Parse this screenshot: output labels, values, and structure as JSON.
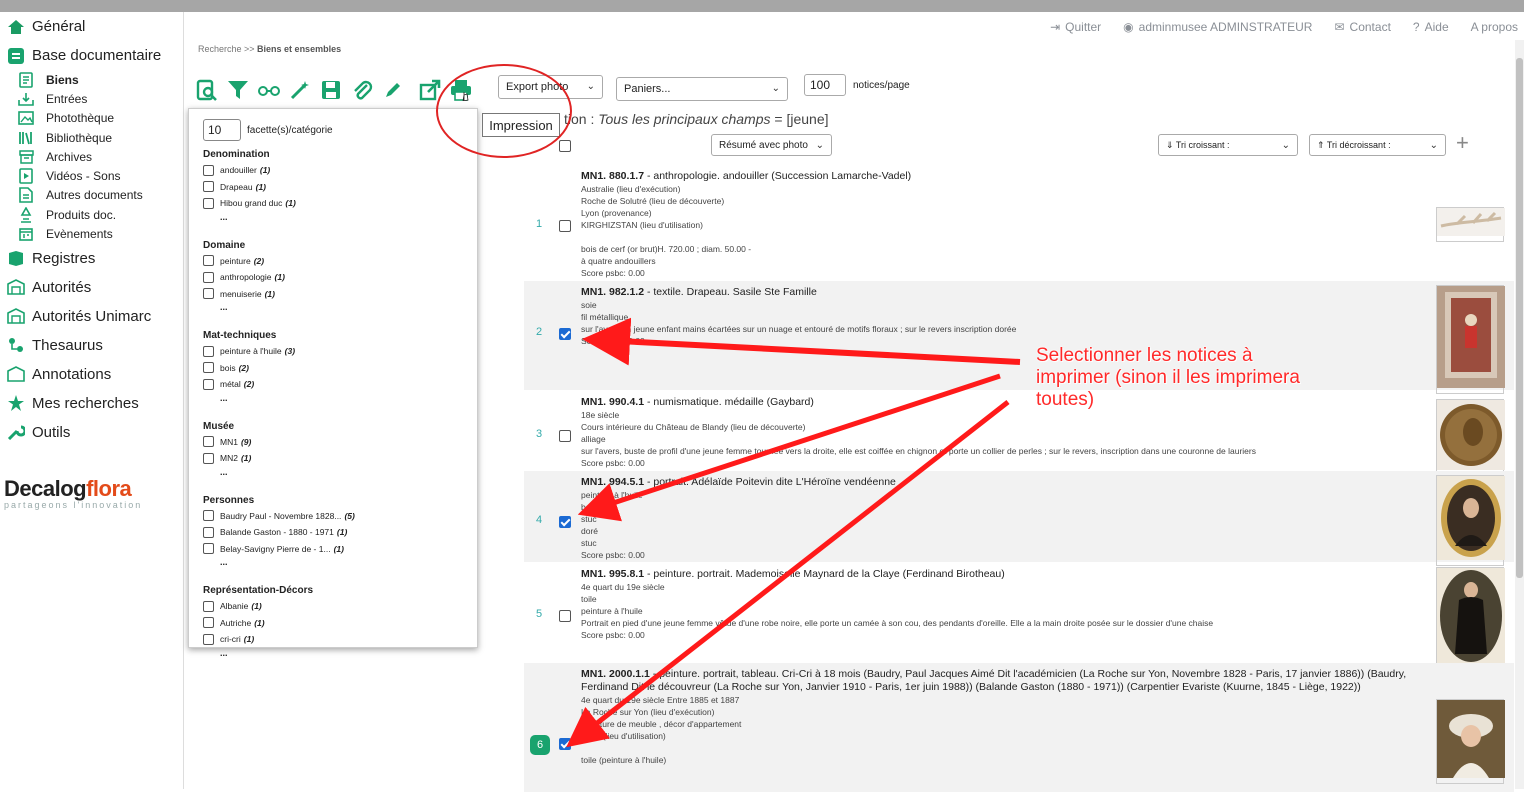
{
  "nav": {
    "items": [
      {
        "label": "Général",
        "icon": "home-icon",
        "color": "#1a9b63"
      },
      {
        "label": "Base documentaire",
        "icon": "database-icon",
        "color": "#19a36e"
      }
    ],
    "sub_items": [
      {
        "label": "Biens",
        "icon": "biens-icon",
        "active": true
      },
      {
        "label": "Entrées",
        "icon": "inbox-icon"
      },
      {
        "label": "Photothèque",
        "icon": "photo-icon"
      },
      {
        "label": "Bibliothèque",
        "icon": "library-icon"
      },
      {
        "label": "Archives",
        "icon": "archive-icon"
      },
      {
        "label": "Vidéos - Sons",
        "icon": "video-icon"
      },
      {
        "label": "Autres documents",
        "icon": "document-icon"
      },
      {
        "label": "Produits doc.",
        "icon": "product-icon"
      },
      {
        "label": "Evènements",
        "icon": "calendar-icon"
      }
    ],
    "items2": [
      {
        "label": "Registres",
        "icon": "register-icon"
      },
      {
        "label": "Autorités",
        "icon": "authority-icon"
      },
      {
        "label": "Autorités Unimarc",
        "icon": "authority-icon"
      },
      {
        "label": "Thesaurus",
        "icon": "thesaurus-icon"
      },
      {
        "label": "Annotations",
        "icon": "annotation-icon"
      },
      {
        "label": "Mes recherches",
        "icon": "star-icon"
      },
      {
        "label": "Outils",
        "icon": "wrench-icon"
      }
    ]
  },
  "logo": {
    "word1": "Decalog",
    "word2": "flora",
    "tagline": "partageons l'innovation"
  },
  "topbar": {
    "quit": "Quitter",
    "user": "adminmusee ADMINSTRATEUR",
    "contact": "Contact",
    "help": "Aide",
    "about": "A propos"
  },
  "breadcrumb": {
    "root": "Recherche >> ",
    "current": "Biens et ensembles"
  },
  "toolbar": {
    "export": "Export photo",
    "baskets": "Paniers...",
    "per_page": "100",
    "per_page_label": "notices/page",
    "tooltip": "Impression"
  },
  "query": {
    "prefix": "tion : ",
    "text": "Tous les principaux champs",
    "suffix": " = [jeune]"
  },
  "sort": {
    "display": "Résumé avec photo",
    "asc": "⇓ Tri croissant :",
    "desc": "⇑ Tri décroissant :",
    "add": "+"
  },
  "facet": {
    "count": "10",
    "count_label": "facette(s)/catégorie",
    "more": "...",
    "groups": [
      {
        "title": "Denomination",
        "items": [
          {
            "label": "andouiller",
            "n": "(1)"
          },
          {
            "label": "Drapeau",
            "n": "(1)"
          },
          {
            "label": "Hibou grand duc",
            "n": "(1)"
          }
        ]
      },
      {
        "title": "Domaine",
        "items": [
          {
            "label": "peinture",
            "n": "(2)"
          },
          {
            "label": "anthropologie",
            "n": "(1)"
          },
          {
            "label": "menuiserie",
            "n": "(1)"
          }
        ]
      },
      {
        "title": "Mat-techniques",
        "items": [
          {
            "label": "peinture à l'huile",
            "n": "(3)"
          },
          {
            "label": "bois",
            "n": "(2)"
          },
          {
            "label": "métal",
            "n": "(2)"
          }
        ]
      },
      {
        "title": "Musée",
        "items": [
          {
            "label": "MN1",
            "n": "(9)"
          },
          {
            "label": "MN2",
            "n": "(1)"
          }
        ]
      },
      {
        "title": "Personnes",
        "items": [
          {
            "label": "Baudry Paul - Novembre 1828...",
            "n": "(5)"
          },
          {
            "label": "Balande Gaston - 1880 - 1971",
            "n": "(1)"
          },
          {
            "label": "Belay-Savigny Pierre de - 1...",
            "n": "(1)"
          }
        ]
      },
      {
        "title": "Représentation-Décors",
        "items": [
          {
            "label": "Albanie",
            "n": "(1)"
          },
          {
            "label": "Autriche",
            "n": "(1)"
          },
          {
            "label": "cri-cri",
            "n": "(1)"
          }
        ]
      }
    ]
  },
  "results": [
    {
      "num": "1",
      "checked": false,
      "id": "MN1. 880.1.7",
      "desc": " - anthropologie. andouiller (Succession Lamarche-Vadel)",
      "lines": [
        "Australie (lieu d'exécution)",
        "Roche de Solutré (lieu de découverte)",
        "Lyon (provenance)",
        "KIRGHIZSTAN (lieu d'utilisation)",
        "",
        "bois de cerf (or brut)H. 720.00 ; diam. 50.00 -",
        "à quatre andouillers",
        "Score psbc: 0.00"
      ],
      "thumb": "antler"
    },
    {
      "num": "2",
      "checked": true,
      "id": "MN1. 982.1.2",
      "desc": " - textile. Drapeau. Sasile Ste Famille",
      "lines": [
        "soie",
        "fil métallique",
        "sur l'avers un jeune enfant mains écartées sur un nuage et entouré de motifs floraux ; sur le revers inscription dorée",
        "Score psbc: 0.00"
      ],
      "thumb": "banner"
    },
    {
      "num": "3",
      "checked": false,
      "id": "MN1. 990.4.1",
      "desc": " - numismatique. médaille (Gaybard)",
      "lines": [
        "18e siècle",
        "Cours intérieure du Château de Blandy (lieu de découverte)",
        "alliage",
        "sur l'avers, buste de profil d'une jeune femme tournée vers la droite, elle est coiffée en chignon et porte un collier de perles ; sur le revers, inscription dans une couronne de lauriers",
        "Score psbc: 0.00"
      ],
      "thumb": "medal"
    },
    {
      "num": "4",
      "checked": true,
      "id": "MN1. 994.5.1",
      "desc": " - portrait. Adélaïde Poitevin dite L'Héroïne vendéenne",
      "lines": [
        "peinture à l'huile",
        "bois",
        "stuc",
        "doré",
        "stuc",
        "Score psbc: 0.00"
      ],
      "thumb": "oval"
    },
    {
      "num": "5",
      "checked": false,
      "id": "MN1. 995.8.1",
      "desc": " - peinture. portrait. Mademoiselle Maynard de la Claye (Ferdinand Birotheau)",
      "lines": [
        "4e quart du 19e siècle",
        "toile",
        "peinture à l'huile",
        "Portrait en pied d'une jeune femme vêtue d'une robe noire, elle porte un camée à son cou, des pendants d'oreille. Elle a la main droite posée sur le dossier d'une chaise",
        "Score psbc: 0.00"
      ],
      "thumb": "lady"
    },
    {
      "num": "6",
      "checked": true,
      "id": "MN1. 2000.1.1",
      "desc": " - peinture. portrait, tableau. Cri-Cri à 18 mois (Baudry, Paul Jacques Aimé Dit l'académicien (La Roche sur Yon, Novembre 1828 - Paris, 17 janvier 1886)) (Baudry, Ferdinand Dit le découvreur (La Roche sur Yon, Janvier 1910 - Paris, 1er juin 1988)) (Balande Gaston (1880 - 1971)) (Carpentier Evariste (Kuurne, 1845 - Liège, 1922))",
      "lines": [
        "4e quart du 19e siècle Entre 1885 et 1887",
        "La Roche sur Yon (lieu d'exécution)",
        "garniture de meuble , décor d'appartement",
        "Paris (lieu d'utilisation)",
        "",
        "toile (peinture à l'huile)"
      ],
      "thumb": "child"
    }
  ],
  "annotation": {
    "text": "Selectionner les notices à imprimer (sinon il les imprimera toutes)",
    "color": "#ff2a2a"
  }
}
